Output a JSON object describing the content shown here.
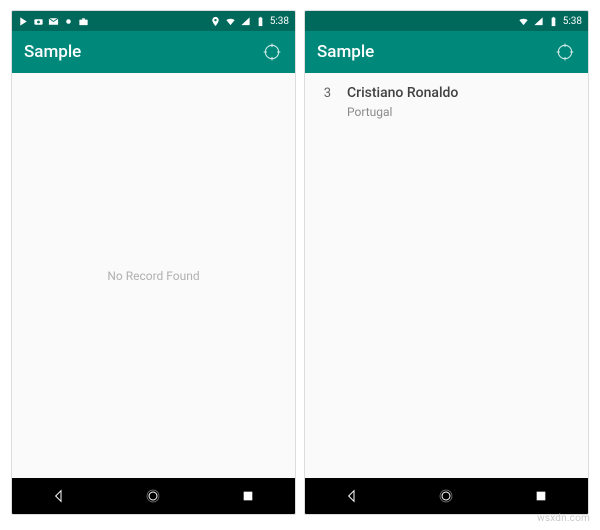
{
  "colors": {
    "primary": "#00897b",
    "primaryDark": "#00695c",
    "background": "#fafafa"
  },
  "status": {
    "time": "5:38"
  },
  "appbar": {
    "title": "Sample"
  },
  "screen1": {
    "empty_message": "No Record Found"
  },
  "screen2": {
    "items": [
      {
        "index": "3",
        "name": "Cristiano Ronaldo",
        "detail": "Portugal"
      }
    ]
  },
  "watermark": "wsxdn.com"
}
